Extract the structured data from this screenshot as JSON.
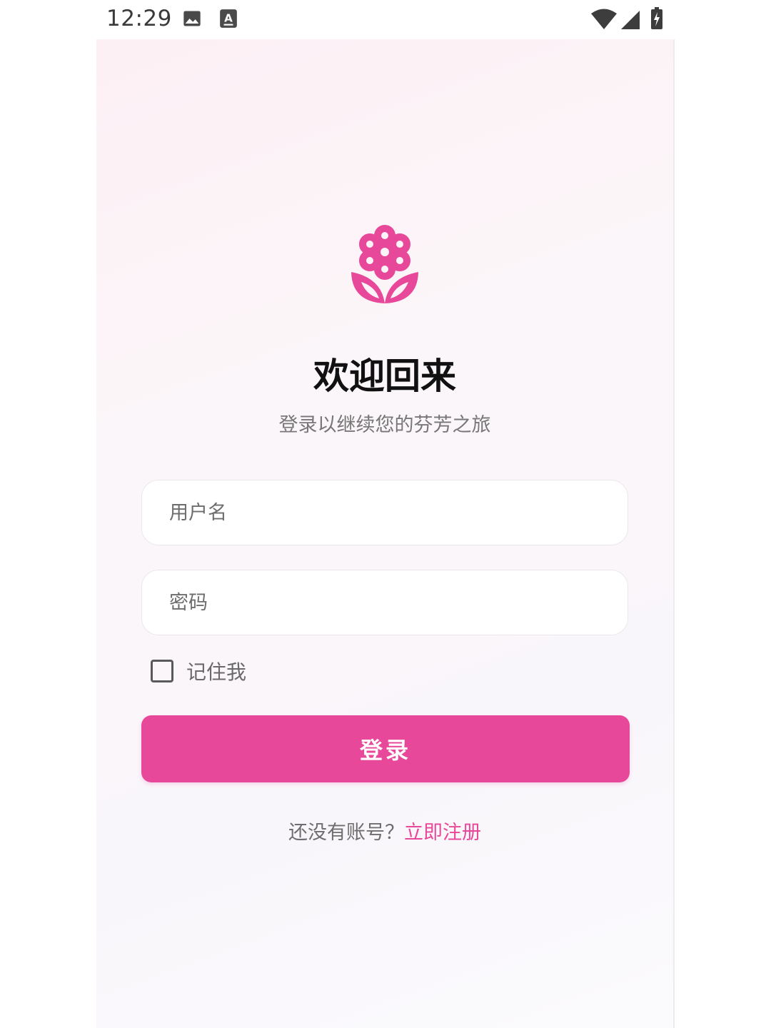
{
  "status_bar": {
    "time": "12:29",
    "icons": [
      "image-icon",
      "keyboard-a-icon",
      "wifi-icon",
      "signal-icon",
      "battery-charging-icon"
    ]
  },
  "brand": {
    "logo_icon": "flower-icon",
    "accent_color": "#e8489a"
  },
  "header": {
    "title": "欢迎回来",
    "subtitle": "登录以继续您的芬芳之旅"
  },
  "form": {
    "username_placeholder": "用户名",
    "username_value": "",
    "password_placeholder": "密码",
    "password_value": "",
    "remember_label": "记住我",
    "remember_checked": false,
    "login_label": "登录"
  },
  "footer": {
    "prompt": "还没有账号？",
    "register_link": "立即注册"
  }
}
